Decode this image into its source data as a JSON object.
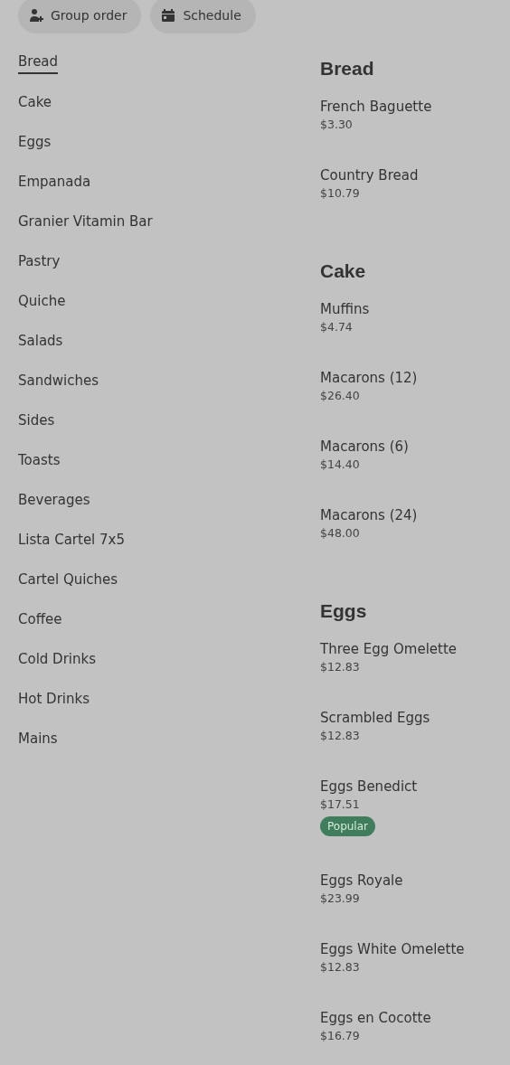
{
  "top_buttons": [
    {
      "kind": "group",
      "label": "Group order"
    },
    {
      "kind": "schedule",
      "label": "Schedule"
    }
  ],
  "categories": [
    {
      "label": "Bread",
      "selected": true
    },
    {
      "label": "Cake",
      "selected": false
    },
    {
      "label": "Eggs",
      "selected": false
    },
    {
      "label": "Empanada",
      "selected": false
    },
    {
      "label": "Granier Vitamin Bar",
      "selected": false
    },
    {
      "label": "Pastry",
      "selected": false
    },
    {
      "label": "Quiche",
      "selected": false
    },
    {
      "label": "Salads",
      "selected": false
    },
    {
      "label": "Sandwiches",
      "selected": false
    },
    {
      "label": "Sides",
      "selected": false
    },
    {
      "label": "Toasts",
      "selected": false
    },
    {
      "label": "Beverages",
      "selected": false
    },
    {
      "label": "Lista Cartel 7x5",
      "selected": false
    },
    {
      "label": "Cartel Quiches",
      "selected": false
    },
    {
      "label": "Coffee",
      "selected": false
    },
    {
      "label": "Cold Drinks",
      "selected": false
    },
    {
      "label": "Hot Drinks",
      "selected": false
    },
    {
      "label": "Mains",
      "selected": false
    }
  ],
  "sections": [
    {
      "title": "Bread",
      "items": [
        {
          "name": "French Baguette",
          "price": "$3.30"
        },
        {
          "name": "Country Bread",
          "price": "$10.79"
        }
      ]
    },
    {
      "title": "Cake",
      "items": [
        {
          "name": "Muffins",
          "price": "$4.74"
        },
        {
          "name": "Macarons (12)",
          "price": "$26.40"
        },
        {
          "name": "Macarons (6)",
          "price": "$14.40"
        },
        {
          "name": "Macarons (24)",
          "price": "$48.00"
        }
      ]
    },
    {
      "title": "Eggs",
      "items": [
        {
          "name": "Three Egg Omelette",
          "price": "$12.83"
        },
        {
          "name": "Scrambled Eggs",
          "price": "$12.83"
        },
        {
          "name": "Eggs Benedict",
          "price": "$17.51",
          "badge": "Popular"
        },
        {
          "name": "Eggs Royale",
          "price": "$23.99"
        },
        {
          "name": "Eggs White Omelette",
          "price": "$12.83"
        },
        {
          "name": "Eggs en Cocotte",
          "price": "$16.79"
        }
      ]
    }
  ]
}
